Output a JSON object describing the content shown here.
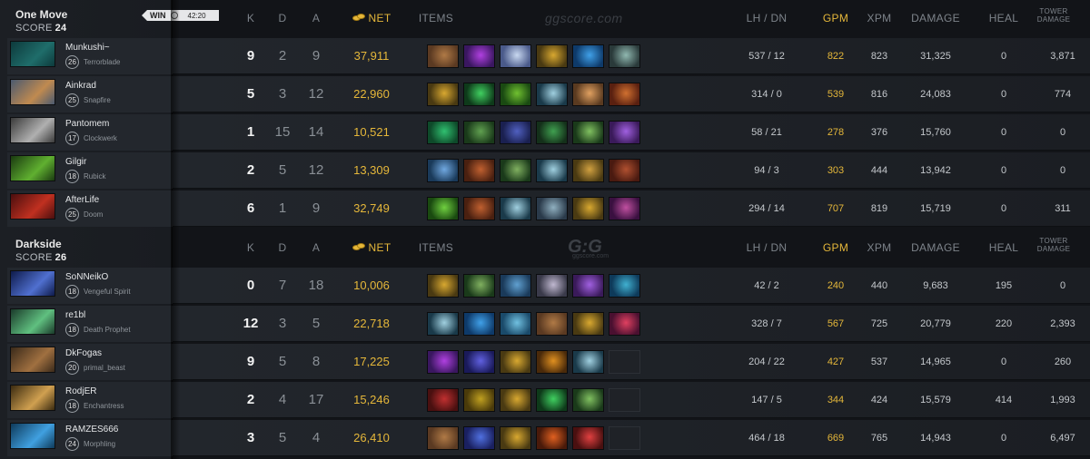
{
  "headers": {
    "k": "K",
    "d": "D",
    "a": "A",
    "net": "NET",
    "items": "ITEMS",
    "lhdn": "LH / DN",
    "gpm": "GPM",
    "xpm": "XPM",
    "damage": "DAMAGE",
    "heal": "HEAL",
    "tower1": "TOWER",
    "tower2": "DAMAGE"
  },
  "watermark": {
    "top": "ggscore.com",
    "mid": "G:G",
    "mid_sub": "ggscore.com"
  },
  "colors": {
    "gold": "#e5b73a",
    "background": "#121418"
  },
  "teams": [
    {
      "name": "One Move",
      "score_label": "SCORE",
      "score": "24",
      "result": "WIN",
      "duration": "42:20",
      "players": [
        {
          "name": "Munkushi~",
          "level": "26",
          "hero": "Terrorblade",
          "k": "9",
          "d": "2",
          "a": "9",
          "net": "37,911",
          "lhdn": "537 / 12",
          "gpm": "822",
          "xpm": "823",
          "damage": "31,325",
          "heal": "0",
          "tower": "3,871",
          "portrait": [
            "#0d3a3c",
            "#1f6d6a"
          ],
          "items": [
            [
              "#5b3a22",
              "#b07a46"
            ],
            [
              "#3a1760",
              "#b040e0"
            ],
            [
              "#4a5a8a",
              "#c8d8f0"
            ],
            [
              "#4a3a12",
              "#d8a830"
            ],
            [
              "#0e3a6a",
              "#40a0e8"
            ],
            [
              "#2a3a3a",
              "#90b8b0"
            ]
          ]
        },
        {
          "name": "Ainkrad",
          "level": "25",
          "hero": "Snapfire",
          "k": "5",
          "d": "3",
          "a": "12",
          "net": "22,960",
          "lhdn": "314 / 0",
          "gpm": "539",
          "xpm": "816",
          "damage": "24,083",
          "heal": "0",
          "tower": "774",
          "portrait": [
            "#4a5a70",
            "#c08a50"
          ],
          "items": [
            [
              "#4a3a12",
              "#d8a830"
            ],
            [
              "#0e3a1a",
              "#40d060"
            ],
            [
              "#1a4a12",
              "#70c030"
            ],
            [
              "#1a3a4a",
              "#a0d0e0"
            ],
            [
              "#5a3a20",
              "#e0a060"
            ],
            [
              "#5a2010",
              "#d07030"
            ]
          ]
        },
        {
          "name": "Pantomem",
          "level": "17",
          "hero": "Clockwerk",
          "k": "1",
          "d": "15",
          "a": "14",
          "net": "10,521",
          "lhdn": "58 / 21",
          "gpm": "278",
          "xpm": "376",
          "damage": "15,760",
          "heal": "0",
          "tower": "0",
          "portrait": [
            "#3a3a3a",
            "#b0b0b0"
          ],
          "items": [
            [
              "#0e4a2a",
              "#30c070"
            ],
            [
              "#1a3a1a",
              "#60a050"
            ],
            [
              "#1a2050",
              "#5060c0"
            ],
            [
              "#14301a",
              "#40a050"
            ],
            [
              "#1a3a1a",
              "#80c060"
            ],
            [
              "#3a1a5a",
              "#a060e0"
            ]
          ]
        },
        {
          "name": "Gilgir",
          "level": "18",
          "hero": "Rubick",
          "k": "2",
          "d": "5",
          "a": "12",
          "net": "13,309",
          "lhdn": "94 / 3",
          "gpm": "303",
          "xpm": "444",
          "damage": "13,942",
          "heal": "0",
          "tower": "0",
          "portrait": [
            "#1a3a10",
            "#60b030"
          ],
          "items": [
            [
              "#1a3a5a",
              "#70a8e0"
            ],
            [
              "#4a2010",
              "#c06030"
            ],
            [
              "#1a3a1a",
              "#80b060"
            ],
            [
              "#1a3a4a",
              "#a0d0e0"
            ],
            [
              "#4a3a12",
              "#d0a040"
            ],
            [
              "#4a1a10",
              "#b05030"
            ]
          ]
        },
        {
          "name": "AfterLife",
          "level": "25",
          "hero": "Doom",
          "k": "6",
          "d": "1",
          "a": "9",
          "net": "32,749",
          "lhdn": "294 / 14",
          "gpm": "707",
          "xpm": "819",
          "damage": "15,719",
          "heal": "0",
          "tower": "311",
          "portrait": [
            "#4a0e0e",
            "#c03020"
          ],
          "items": [
            [
              "#1a4a10",
              "#70d040"
            ],
            [
              "#4a2010",
              "#c06030"
            ],
            [
              "#1a3a4a",
              "#a0d0e0"
            ],
            [
              "#2a3a4a",
              "#90b0c0"
            ],
            [
              "#4a3a12",
              "#d8a830"
            ],
            [
              "#3a1040",
              "#c050a0"
            ]
          ]
        }
      ]
    },
    {
      "name": "Darkside",
      "score_label": "SCORE",
      "score": "26",
      "players": [
        {
          "name": "SoNNeikO",
          "level": "18",
          "hero": "Vengeful Spirit",
          "k": "0",
          "d": "7",
          "a": "18",
          "net": "10,006",
          "lhdn": "42 / 2",
          "gpm": "240",
          "xpm": "440",
          "damage": "9,683",
          "heal": "195",
          "tower": "0",
          "portrait": [
            "#0e1a4a",
            "#5070d0"
          ],
          "items": [
            [
              "#4a3a12",
              "#d8a830"
            ],
            [
              "#1a3a1a",
              "#80b060"
            ],
            [
              "#1a3a5a",
              "#60a0d0"
            ],
            [
              "#3a3a4a",
              "#c0b8d0"
            ],
            [
              "#3a1a5a",
              "#a060e0"
            ],
            [
              "#0e3a5a",
              "#40b0d0"
            ]
          ]
        },
        {
          "name": "re1bl",
          "level": "18",
          "hero": "Death Prophet",
          "k": "12",
          "d": "3",
          "a": "5",
          "net": "22,718",
          "lhdn": "328 / 7",
          "gpm": "567",
          "xpm": "725",
          "damage": "20,779",
          "heal": "220",
          "tower": "2,393",
          "portrait": [
            "#1a3a2a",
            "#60c080"
          ],
          "items": [
            [
              "#1a3a4a",
              "#a0d0e0"
            ],
            [
              "#0e3a6a",
              "#40a0e8"
            ],
            [
              "#1a4a6a",
              "#70c0e0"
            ],
            [
              "#5b3a22",
              "#b07a46"
            ],
            [
              "#4a3a12",
              "#d8a830"
            ],
            [
              "#4a1030",
              "#e04060"
            ]
          ]
        },
        {
          "name": "DkFogas",
          "level": "20",
          "hero": "primal_beast",
          "k": "9",
          "d": "5",
          "a": "8",
          "net": "17,225",
          "lhdn": "204 / 22",
          "gpm": "427",
          "xpm": "537",
          "damage": "14,965",
          "heal": "0",
          "tower": "260",
          "portrait": [
            "#3a2a1a",
            "#a07040"
          ],
          "items": [
            [
              "#3a1760",
              "#b040e0"
            ],
            [
              "#1a1a5a",
              "#6060e0"
            ],
            [
              "#4a3a12",
              "#d8a830"
            ],
            [
              "#4a2a0a",
              "#e09020"
            ],
            [
              "#1a3a4a",
              "#a0d0e0"
            ],
            null
          ]
        },
        {
          "name": "RodjER",
          "level": "18",
          "hero": "Enchantress",
          "k": "2",
          "d": "4",
          "a": "17",
          "net": "15,246",
          "lhdn": "147 / 5",
          "gpm": "344",
          "xpm": "424",
          "damage": "15,579",
          "heal": "414",
          "tower": "1,993",
          "portrait": [
            "#3a2a10",
            "#d0a050"
          ],
          "items": [
            [
              "#4a1010",
              "#c03030"
            ],
            [
              "#4a3a0a",
              "#c0a020"
            ],
            [
              "#4a3a12",
              "#d8a830"
            ],
            [
              "#0e3a1a",
              "#40d060"
            ],
            [
              "#1a3a1a",
              "#80c060"
            ],
            null
          ]
        },
        {
          "name": "RAMZES666",
          "level": "24",
          "hero": "Morphling",
          "k": "3",
          "d": "5",
          "a": "4",
          "net": "26,410",
          "lhdn": "464 / 18",
          "gpm": "669",
          "xpm": "765",
          "damage": "14,943",
          "heal": "0",
          "tower": "6,497",
          "portrait": [
            "#0e3a5a",
            "#40a0e0"
          ],
          "items": [
            [
              "#5b3a22",
              "#b07a46"
            ],
            [
              "#1a2060",
              "#5070e0"
            ],
            [
              "#4a3a12",
              "#d8a830"
            ],
            [
              "#4a1a0a",
              "#e06020"
            ],
            [
              "#4a1010",
              "#e04040"
            ],
            null
          ]
        }
      ]
    }
  ]
}
